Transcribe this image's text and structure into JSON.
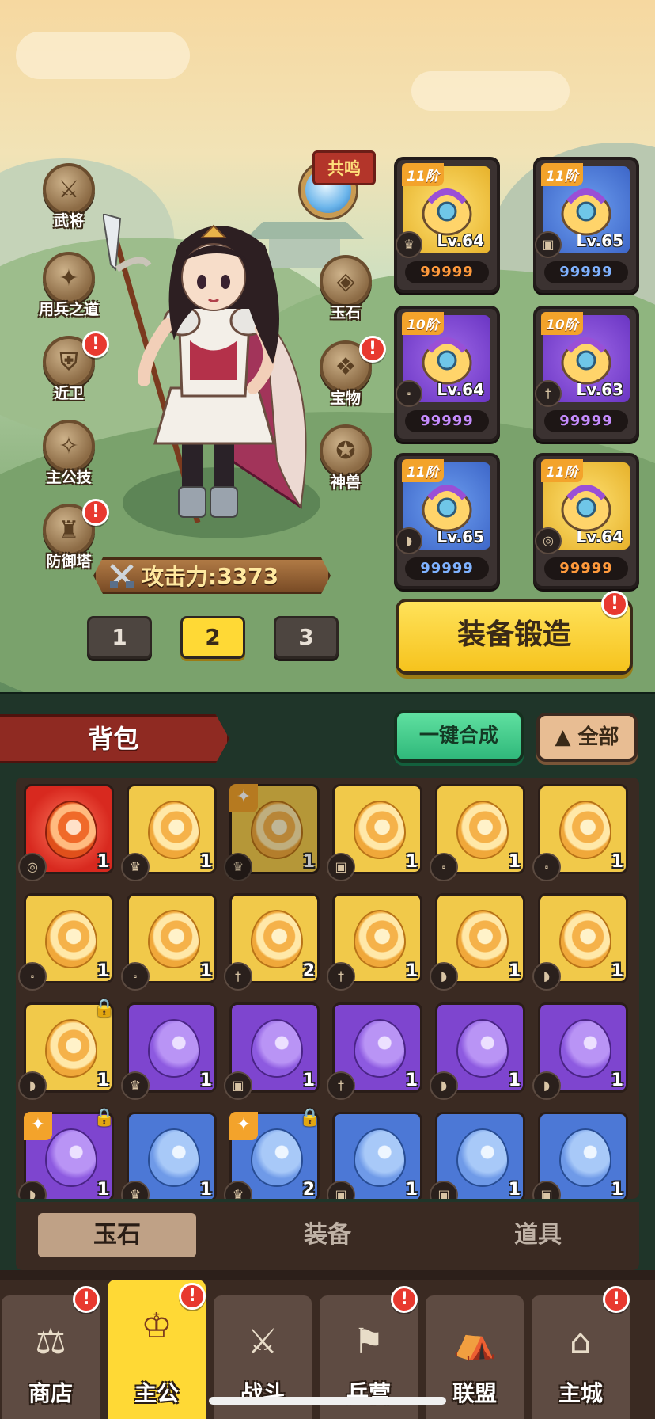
{
  "side_left": [
    {
      "label": "武将",
      "icon": "general-icon",
      "badge": false
    },
    {
      "label": "用兵之道",
      "icon": "strategy-icon",
      "badge": false
    },
    {
      "label": "近卫",
      "icon": "guard-icon",
      "badge": true
    },
    {
      "label": "主公技",
      "icon": "skill-icon",
      "badge": false
    },
    {
      "label": "防御塔",
      "icon": "tower-icon",
      "badge": true
    }
  ],
  "side_right": [
    {
      "label": "玉石",
      "icon": "jade-icon",
      "badge": false
    },
    {
      "label": "宝物",
      "icon": "treasure-icon",
      "badge": true
    },
    {
      "label": "神兽",
      "icon": "beast-icon",
      "badge": false
    }
  ],
  "resonate_label": "共鸣",
  "power": {
    "label": "攻击力:",
    "value": "3373"
  },
  "loadout_tabs": [
    "1",
    "2",
    "3"
  ],
  "loadout_active": "2",
  "equipment": [
    {
      "rank": "11阶",
      "level": "Lv.64",
      "score": "99999",
      "rarity": "gold",
      "slot": "helmet-icon"
    },
    {
      "rank": "11阶",
      "level": "Lv.65",
      "score": "99999",
      "rarity": "blue",
      "slot": "armor-icon"
    },
    {
      "rank": "10阶",
      "level": "Lv.64",
      "score": "99999",
      "rarity": "purple",
      "slot": "boots-icon"
    },
    {
      "rank": "10阶",
      "level": "Lv.63",
      "score": "99999",
      "rarity": "purple",
      "slot": "sword-icon"
    },
    {
      "rank": "11阶",
      "level": "Lv.65",
      "score": "99999",
      "rarity": "blue",
      "slot": "bracer-icon"
    },
    {
      "rank": "11阶",
      "level": "Lv.64",
      "score": "99999",
      "rarity": "gold",
      "slot": "ring-icon"
    }
  ],
  "forge_label": "装备锻造",
  "bag": {
    "title": "背包",
    "merge_label": "一键合成",
    "filter_label": "全部",
    "items": [
      {
        "rarity": "red",
        "count": "1",
        "slot": "ring-icon"
      },
      {
        "rarity": "gold",
        "count": "1",
        "slot": "helmet-icon"
      },
      {
        "rarity": "gold",
        "count": "1",
        "slot": "helmet-icon",
        "star": true,
        "dim": true
      },
      {
        "rarity": "gold",
        "count": "1",
        "slot": "armor-icon"
      },
      {
        "rarity": "gold",
        "count": "1",
        "slot": "boots-icon"
      },
      {
        "rarity": "gold",
        "count": "1",
        "slot": "boots-icon"
      },
      {
        "rarity": "gold",
        "count": "1",
        "slot": "boots-icon"
      },
      {
        "rarity": "gold",
        "count": "1",
        "slot": "boots-icon"
      },
      {
        "rarity": "gold",
        "count": "2",
        "slot": "sword-icon"
      },
      {
        "rarity": "gold",
        "count": "1",
        "slot": "sword-icon"
      },
      {
        "rarity": "gold",
        "count": "1",
        "slot": "bracer-icon"
      },
      {
        "rarity": "gold",
        "count": "1",
        "slot": "bracer-icon"
      },
      {
        "rarity": "gold",
        "count": "1",
        "slot": "bracer-icon",
        "lock": true
      },
      {
        "rarity": "purple",
        "count": "1",
        "slot": "helmet-icon"
      },
      {
        "rarity": "purple",
        "count": "1",
        "slot": "armor-icon"
      },
      {
        "rarity": "purple",
        "count": "1",
        "slot": "sword-icon"
      },
      {
        "rarity": "purple",
        "count": "1",
        "slot": "bracer-icon"
      },
      {
        "rarity": "purple",
        "count": "1",
        "slot": "bracer-icon"
      },
      {
        "rarity": "purple",
        "count": "1",
        "slot": "bracer-icon",
        "star": true,
        "lock": true
      },
      {
        "rarity": "blue",
        "count": "1",
        "slot": "helmet-icon"
      },
      {
        "rarity": "blue",
        "count": "2",
        "slot": "helmet-icon",
        "star": true,
        "lock": true
      },
      {
        "rarity": "blue",
        "count": "1",
        "slot": "armor-icon"
      },
      {
        "rarity": "blue",
        "count": "1",
        "slot": "armor-icon"
      },
      {
        "rarity": "blue",
        "count": "1",
        "slot": "armor-icon"
      }
    ]
  },
  "subtabs": [
    "玉石",
    "装备",
    "道具"
  ],
  "subtab_active": "玉石",
  "nav": [
    {
      "label": "商店",
      "icon": "shop-icon",
      "badge": true
    },
    {
      "label": "主公",
      "icon": "lord-icon",
      "badge": true,
      "active": true
    },
    {
      "label": "战斗",
      "icon": "battle-icon",
      "badge": false
    },
    {
      "label": "兵营",
      "icon": "barracks-icon",
      "badge": true
    },
    {
      "label": "联盟",
      "icon": "alliance-icon",
      "badge": false
    },
    {
      "label": "主城",
      "icon": "city-icon",
      "badge": true
    }
  ],
  "badge_symbol": "!",
  "colors": {
    "accent": "#ffd935",
    "gold": "#f1c94a",
    "purple": "#7e45cf",
    "blue": "#4c78d6",
    "red": "#d8291f",
    "alert": "#e8392f"
  }
}
